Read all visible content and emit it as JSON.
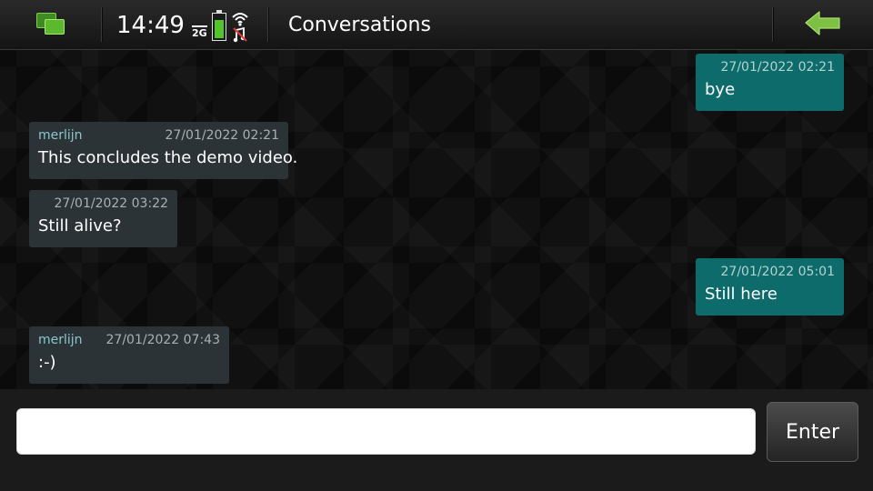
{
  "statusbar": {
    "time": "14:49",
    "network": "2G",
    "battery_level": 0.8
  },
  "header": {
    "title": "Conversations"
  },
  "messages": [
    {
      "direction": "outgoing",
      "sender": "",
      "timestamp": "27/01/2022 02:21",
      "text": "bye"
    },
    {
      "direction": "incoming",
      "sender": "merlijn",
      "timestamp": "27/01/2022 02:21",
      "text": "This concludes the demo video."
    },
    {
      "direction": "incoming",
      "sender": "",
      "timestamp": "27/01/2022 03:22",
      "text": "Still alive?"
    },
    {
      "direction": "outgoing",
      "sender": "",
      "timestamp": "27/01/2022 05:01",
      "text": "Still here"
    },
    {
      "direction": "incoming",
      "sender": "merlijn",
      "timestamp": "27/01/2022 07:43",
      "text": ":-)"
    }
  ],
  "composer": {
    "value": "",
    "placeholder": "",
    "send_label": "Enter"
  },
  "colors": {
    "incoming_bubble": "#2c3337",
    "outgoing_bubble": "#0e6b6b",
    "accent_green": "#53c42d"
  },
  "icons": {
    "switcher": "task-switcher-icon",
    "battery": "battery-icon",
    "wifi": "wifi-icon",
    "back": "back-arrow-icon"
  }
}
